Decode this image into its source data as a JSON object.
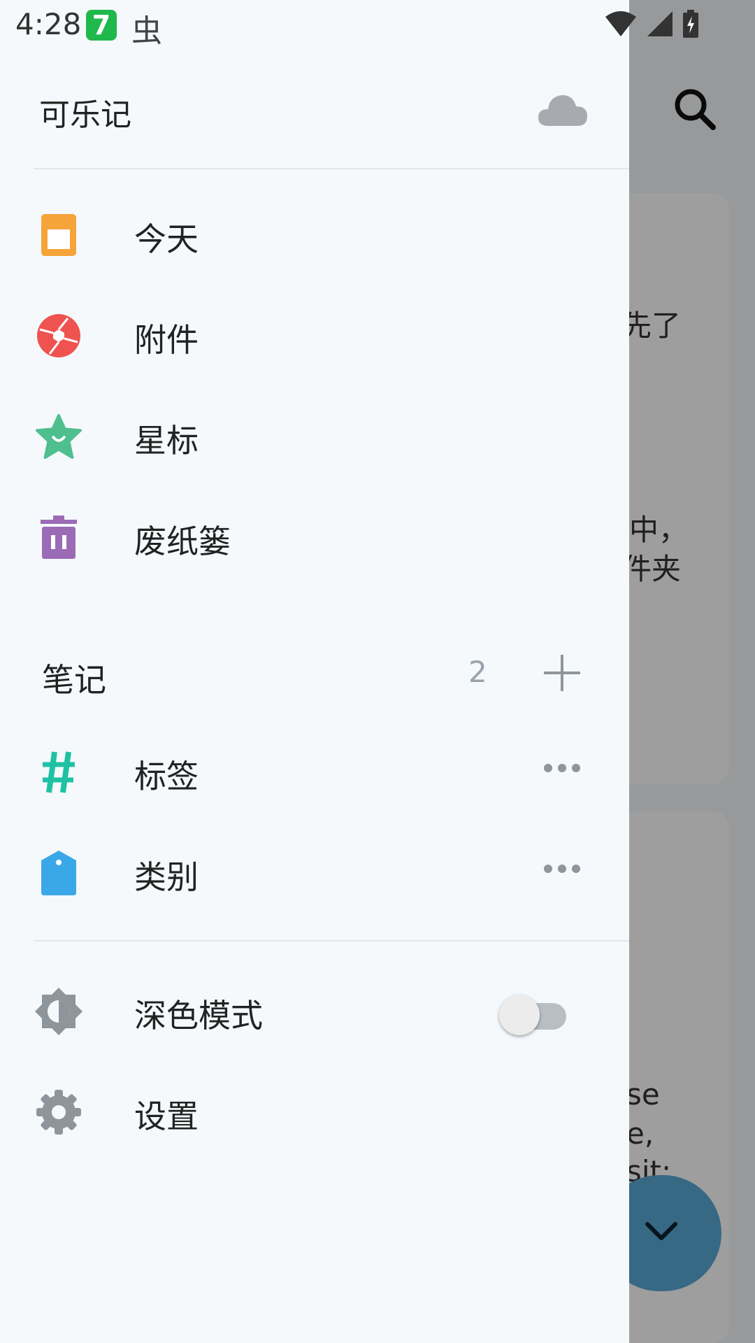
{
  "status_bar": {
    "time": "4:28",
    "app_icon_1_glyph": "7",
    "app_icon_2_glyph": "虫"
  },
  "drawer": {
    "title": "可乐记",
    "nav_items": [
      {
        "label": "今天",
        "icon": "today-icon",
        "color": "#f5a43a"
      },
      {
        "label": "附件",
        "icon": "camera-shutter-icon",
        "color": "#ef5350"
      },
      {
        "label": "星标",
        "icon": "star-icon",
        "color": "#4fbf8f"
      },
      {
        "label": "废纸篓",
        "icon": "trash-icon",
        "color": "#9c6bb5"
      }
    ],
    "notes_section": {
      "label": "笔记",
      "count": "2"
    },
    "group_items": [
      {
        "label": "标签",
        "icon": "hashtag-icon",
        "color": "#1ec2a3"
      },
      {
        "label": "类别",
        "icon": "category-tag-icon",
        "color": "#3aa8e8"
      }
    ],
    "settings_items": [
      {
        "label": "深色模式",
        "icon": "dark-mode-icon",
        "toggle_on": false
      },
      {
        "label": "设置",
        "icon": "gear-icon"
      }
    ]
  },
  "background": {
    "card_text": [
      "先了",
      "中，",
      "件夹",
      "se",
      "e,",
      "sit:"
    ]
  }
}
